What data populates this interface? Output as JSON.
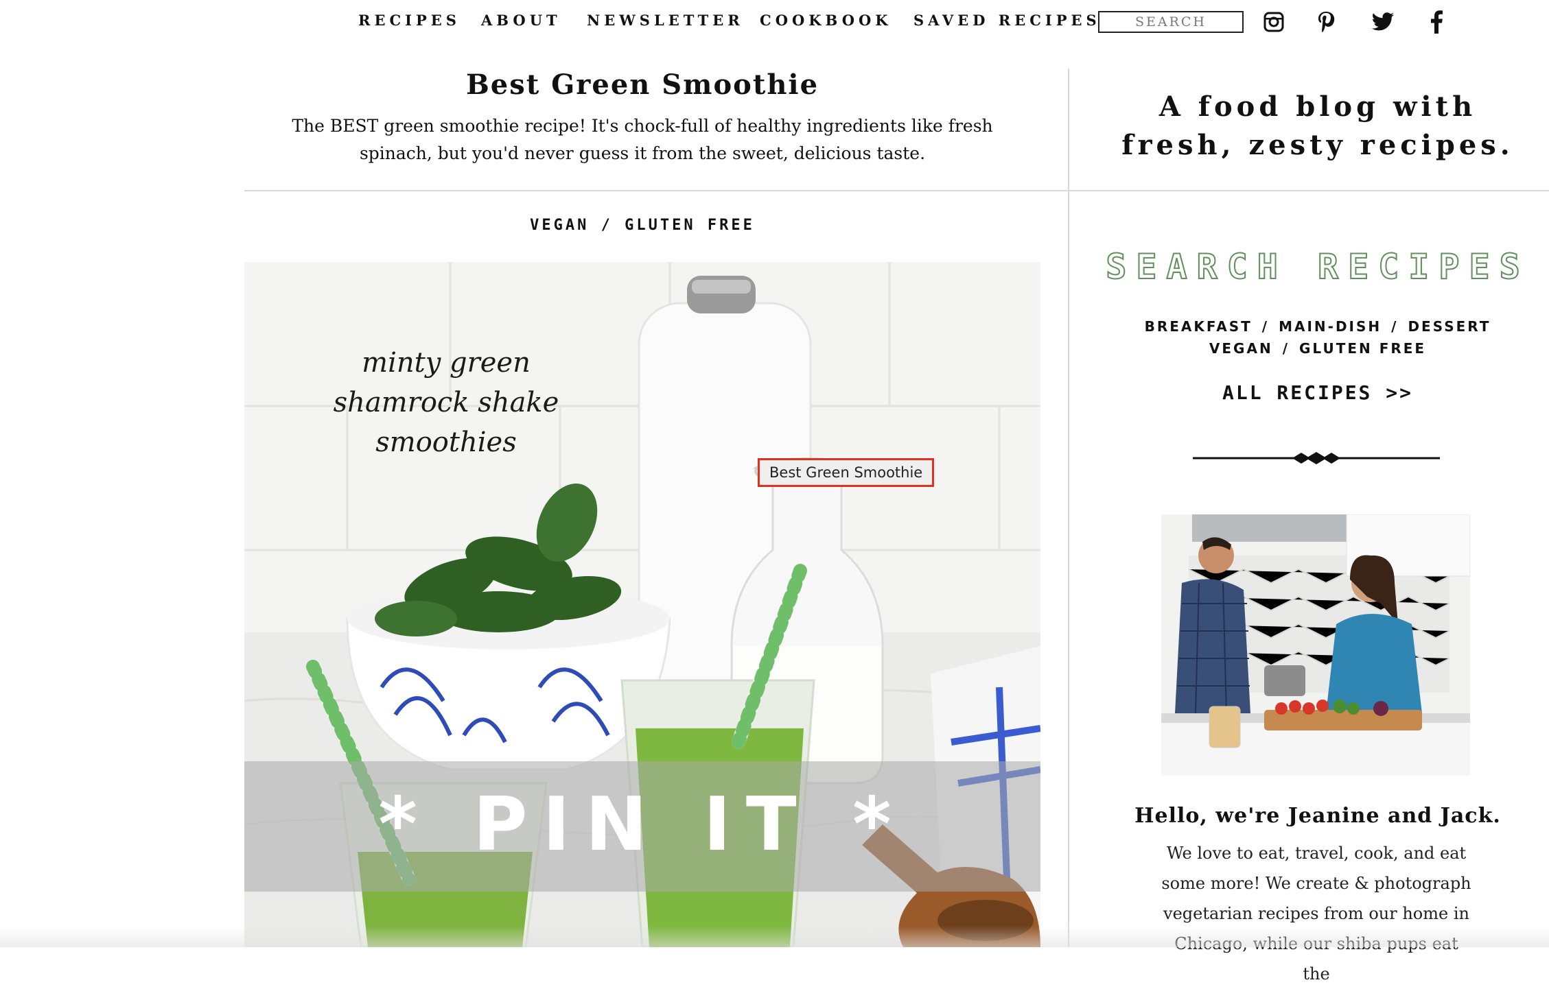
{
  "nav": {
    "items": [
      "RECIPES",
      "ABOUT",
      "NEWSLETTER",
      "COOKBOOK",
      "SAVED RECIPES"
    ],
    "search_placeholder": "SEARCH",
    "social": [
      "instagram-icon",
      "pinterest-icon",
      "twitter-icon",
      "facebook-icon"
    ]
  },
  "post": {
    "title": "Best Green Smoothie",
    "description": "The BEST green smoothie recipe! It's chock-full of healthy ingredients like fresh spinach, but you'd never guess it from the sweet, delicious taste.",
    "categories": "VEGAN / GLUTEN FREE",
    "image_script_text": [
      "minty green",
      "shamrock shake",
      "smoothies"
    ],
    "tooltip": "Best Green Smoothie",
    "pin_label": "* PIN IT *"
  },
  "sidebar": {
    "tagline_line1": "A food blog with",
    "tagline_line2": "fresh, zesty recipes.",
    "search_heading": "SEARCH RECIPES",
    "category_row1": [
      "BREAKFAST",
      "MAIN-DISH",
      "DESSERT"
    ],
    "category_row2": [
      "VEGAN",
      "GLUTEN FREE"
    ],
    "separator": "/",
    "all_recipes": "ALL RECIPES >>",
    "hello": "Hello, we're Jeanine and Jack.",
    "bio": "We love to eat, travel, cook, and eat some more! We create & photograph vegetarian recipes from our home in Chicago, while our shiba pups eat the"
  },
  "colors": {
    "accent_green": "#5f8f5a",
    "tooltip_border": "#e0301e",
    "divider": "#d9d9d9"
  }
}
